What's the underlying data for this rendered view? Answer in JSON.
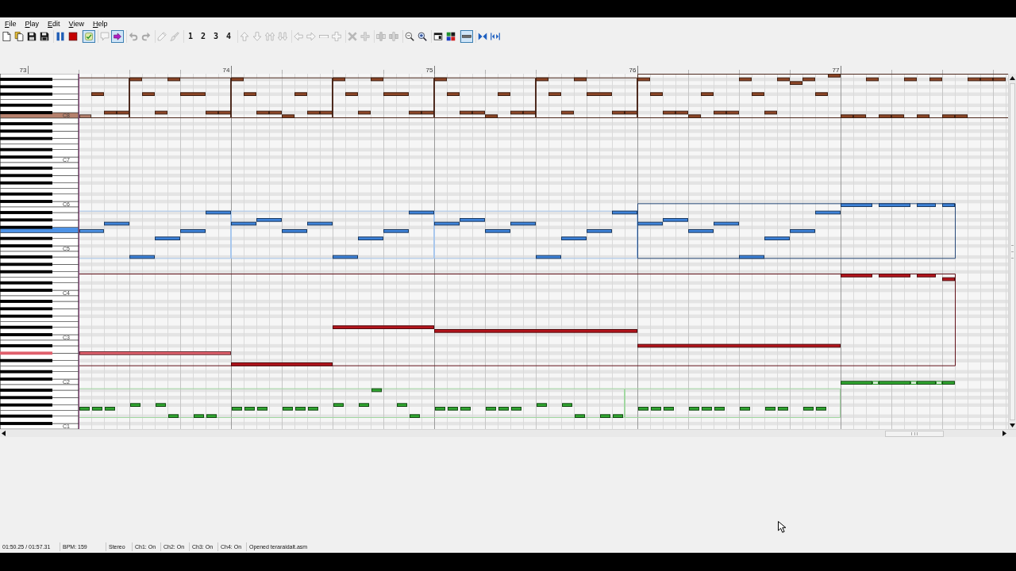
{
  "menu": [
    "File",
    "Play",
    "Edit",
    "View",
    "Help"
  ],
  "toolbar": [
    [
      {
        "pressed": false,
        "disabled": false
      },
      {
        "pressed": false,
        "disabled": false
      },
      {
        "pressed": false,
        "disabled": false
      },
      {
        "pressed": false,
        "disabled": false
      }
    ],
    [
      {
        "pressed": false,
        "disabled": false
      },
      {
        "pressed": false,
        "disabled": false
      }
    ],
    [
      {
        "pressed": true,
        "disabled": false
      }
    ],
    [
      {
        "pressed": false,
        "disabled": true
      },
      {
        "pressed": true,
        "disabled": false
      }
    ],
    [
      {
        "pressed": false,
        "disabled": true
      },
      {
        "pressed": false,
        "disabled": true
      }
    ],
    [
      {
        "pressed": false,
        "disabled": true
      },
      {
        "pressed": false,
        "disabled": true
      }
    ],
    [
      {
        "label": "1",
        "pressed": false,
        "disabled": false
      },
      {
        "label": "2",
        "pressed": false,
        "disabled": false
      },
      {
        "label": "3",
        "pressed": false,
        "disabled": false
      },
      {
        "label": "4",
        "pressed": false,
        "disabled": false
      }
    ],
    [
      {
        "pressed": false,
        "disabled": true
      },
      {
        "pressed": false,
        "disabled": true
      },
      {
        "pressed": false,
        "disabled": true
      },
      {
        "pressed": false,
        "disabled": true
      }
    ],
    [
      {
        "pressed": false,
        "disabled": true
      },
      {
        "pressed": false,
        "disabled": true
      },
      {
        "pressed": false,
        "disabled": true
      },
      {
        "pressed": false,
        "disabled": true
      }
    ],
    [
      {
        "pressed": false,
        "disabled": true
      },
      {
        "pressed": false,
        "disabled": true
      }
    ],
    [
      {
        "pressed": false,
        "disabled": true
      },
      {
        "pressed": false,
        "disabled": true
      }
    ],
    [
      {
        "pressed": false,
        "disabled": false
      },
      {
        "pressed": false,
        "disabled": false
      }
    ],
    [
      {
        "pressed": false,
        "disabled": false
      },
      {
        "pressed": false,
        "disabled": false
      }
    ],
    [
      {
        "pressed": true,
        "disabled": false
      }
    ],
    [
      {
        "pressed": false,
        "disabled": false
      },
      {
        "pressed": false,
        "disabled": false
      }
    ]
  ],
  "ruler": {
    "measures": [
      "73",
      "74",
      "75",
      "76",
      "77"
    ]
  },
  "keyboard": {
    "octaves": [
      {
        "label": "C8",
        "keys": [
          {
            "pressed": true,
            "color": "#b5806c"
          },
          {
            "pressed": false
          },
          {
            "pressed": false
          },
          {
            "pressed": false
          },
          {
            "pressed": false
          },
          {
            "pressed": false
          },
          {
            "pressed": false
          },
          {
            "pressed": false
          },
          {
            "pressed": false
          },
          {
            "pressed": false
          },
          {
            "pressed": false
          },
          {
            "pressed": false
          }
        ]
      },
      {
        "label": "C7",
        "keys": [
          {
            "pressed": false
          },
          {
            "pressed": false
          },
          {
            "pressed": false
          },
          {
            "pressed": false
          },
          {
            "pressed": false
          },
          {
            "pressed": false
          },
          {
            "pressed": false
          },
          {
            "pressed": false
          },
          {
            "pressed": false
          },
          {
            "pressed": false
          },
          {
            "pressed": false
          },
          {
            "pressed": false
          }
        ]
      },
      {
        "label": "C6",
        "keys": [
          {
            "pressed": false
          },
          {
            "pressed": false
          },
          {
            "pressed": false
          },
          {
            "pressed": false
          },
          {
            "pressed": false
          },
          {
            "pressed": false
          },
          {
            "pressed": false
          },
          {
            "pressed": false
          },
          {
            "pressed": false
          },
          {
            "pressed": false
          },
          {
            "pressed": false
          },
          {
            "pressed": false
          }
        ]
      },
      {
        "label": "C5",
        "keys": [
          {
            "pressed": false
          },
          {
            "pressed": false
          },
          {
            "pressed": false
          },
          {
            "pressed": false
          },
          {
            "pressed": false
          },
          {
            "pressed": true,
            "color": "#4d92e6"
          },
          {
            "pressed": false
          },
          {
            "pressed": false
          },
          {
            "pressed": false
          },
          {
            "pressed": false
          },
          {
            "pressed": false
          },
          {
            "pressed": false
          }
        ]
      },
      {
        "label": "C4",
        "keys": [
          {
            "pressed": false
          },
          {
            "pressed": false
          },
          {
            "pressed": false
          },
          {
            "pressed": false
          },
          {
            "pressed": false
          },
          {
            "pressed": false
          },
          {
            "pressed": false
          },
          {
            "pressed": false
          },
          {
            "pressed": false
          },
          {
            "pressed": false
          },
          {
            "pressed": false
          },
          {
            "pressed": false
          }
        ]
      },
      {
        "label": "C3",
        "keys": [
          {
            "pressed": false
          },
          {
            "pressed": false
          },
          {
            "pressed": false
          },
          {
            "pressed": false
          },
          {
            "pressed": false
          },
          {
            "pressed": false
          },
          {
            "pressed": false
          },
          {
            "pressed": false
          },
          {
            "pressed": false
          },
          {
            "pressed": false
          },
          {
            "pressed": false
          },
          {
            "pressed": false
          }
        ]
      },
      {
        "label": "C2",
        "keys": [
          {
            "pressed": false
          },
          {
            "pressed": false
          },
          {
            "pressed": false
          },
          {
            "pressed": false
          },
          {
            "pressed": false
          },
          {
            "pressed": false
          },
          {
            "pressed": false
          },
          {
            "pressed": false
          },
          {
            "pressed": true,
            "color": "#e0606c"
          },
          {
            "pressed": false
          },
          {
            "pressed": false
          },
          {
            "pressed": false
          }
        ]
      },
      {
        "label": "C1",
        "keys": [
          {
            "pressed": false
          },
          {
            "pressed": false
          },
          {
            "pressed": false
          },
          {
            "pressed": false
          },
          {
            "pressed": false
          },
          {
            "pressed": false
          },
          {
            "pressed": false
          },
          {
            "pressed": false
          },
          {
            "pressed": false
          },
          {
            "pressed": false
          },
          {
            "pressed": false
          },
          {
            "pressed": false
          }
        ]
      }
    ]
  },
  "tracks": [
    {
      "color": "#8b4526"
    },
    {
      "color": "#3d82d8"
    },
    {
      "color": "#b3141c"
    },
    {
      "color": "#2fa52f"
    }
  ],
  "status_bar": [
    "01:50.25 / 01:57.31",
    "BPM: 159",
    "Stereo",
    "Ch1: On",
    "Ch2: On",
    "Ch3: On",
    "Ch4: On",
    "Opened teraraidalt.asm"
  ]
}
